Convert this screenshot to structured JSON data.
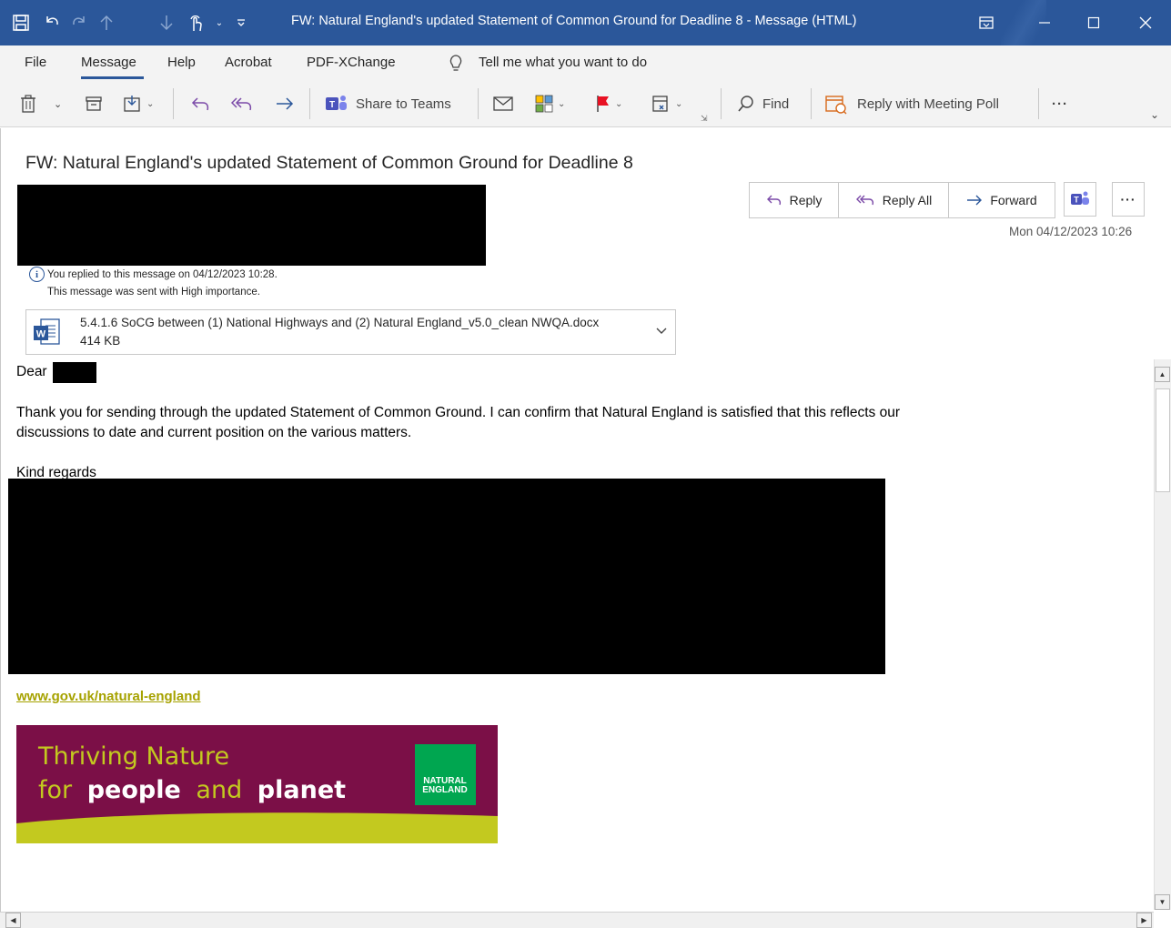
{
  "window": {
    "title": "FW: Natural England's updated Statement of Common Ground for Deadline 8  -  Message (HTML)",
    "title_bar_color": "#2b579a"
  },
  "menu": {
    "items": [
      "File",
      "Message",
      "Help",
      "Acrobat",
      "PDF-XChange"
    ],
    "active": "Message",
    "tell_me": "Tell me what you want to do"
  },
  "ribbon": {
    "share_to_teams": "Share to Teams",
    "find": "Find",
    "reply_with_meeting_poll": "Reply with Meeting Poll",
    "more": "···"
  },
  "message": {
    "subject": "FW: Natural England's updated Statement of Common Ground for Deadline 8",
    "actions": {
      "reply": "Reply",
      "reply_all": "Reply All",
      "forward": "Forward",
      "more": "···"
    },
    "timestamp": "Mon 04/12/2023 10:26",
    "info_replied": "You replied to this message on 04/12/2023 10:28.",
    "info_importance": "This message was sent with High importance.",
    "attachment": {
      "name": "5.4.1.6 SoCG between (1) National Highways and (2) Natural England_v5.0_clean NWQA.docx",
      "size": "414 KB"
    },
    "body": {
      "greeting": "Dear",
      "paragraph_line1": "Thank you for sending through the updated Statement of Common Ground.  I can confirm that Natural England is satisfied that this reflects our",
      "paragraph_line2": "discussions to date and current position on the various matters.",
      "closing": "Kind regards",
      "link": "www.gov.uk/natural-england"
    },
    "banner": {
      "line1": "Thriving Nature",
      "line2_for": "for",
      "line2_people": "people",
      "line2_and": "and",
      "line2_planet": "planet",
      "logo_line1": "NATURAL",
      "logo_line2": "ENGLAND",
      "bg_color": "#7b0f47",
      "accent_color": "#c3c91f",
      "logo_color": "#00a650"
    }
  }
}
